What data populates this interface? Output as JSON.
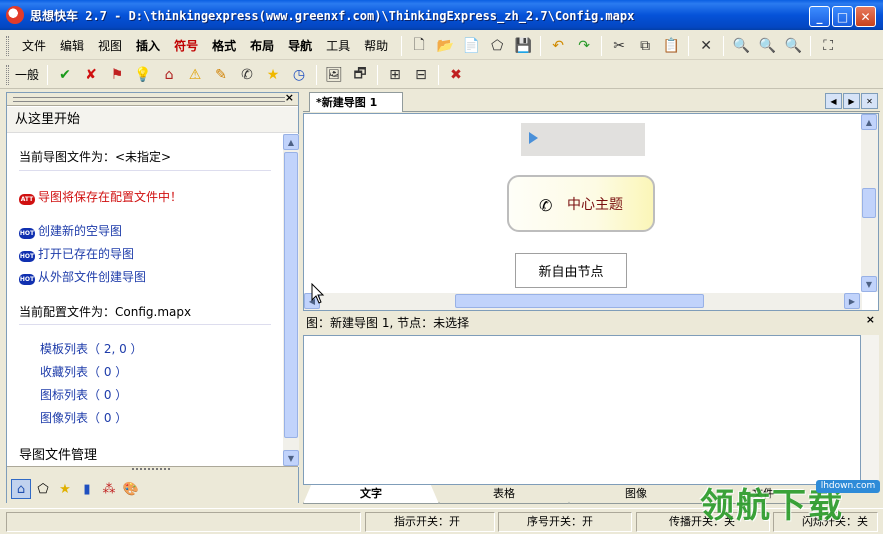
{
  "window": {
    "title": "思想快车 2.7 - D:\\thinkingexpress(www.greenxf.com)\\ThinkingExpress_zh_2.7\\Config.mapx",
    "minimize": "_",
    "maximize": "□",
    "close": "✕"
  },
  "menu": [
    "文件",
    "编辑",
    "视图",
    "插入",
    "符号",
    "格式",
    "布局",
    "导航",
    "工具",
    "帮助"
  ],
  "toolbar2": {
    "label": "一般"
  },
  "left_panel": {
    "close": "×",
    "header": "从这里开始",
    "current_map_label": "当前导图文件为：<未指定>",
    "warning_badge": "ATT",
    "warning_text": "导图将保存在配置文件中！",
    "hot_badge": "HOT",
    "links": [
      "创建新的空导图",
      "打开已存在的导图",
      "从外部文件创建导图"
    ],
    "config_label": "当前配置文件为：Config.mapx",
    "lists": [
      "模板列表（ 2, 0 ）",
      "收藏列表（ 0 ）",
      "图标列表（ 0 ）",
      "图像列表（ 0 ）"
    ],
    "section": "导图文件管理"
  },
  "doc_tab": "*新建导图 1",
  "canvas": {
    "central_topic": "中心主题",
    "free_node": "新自由节点"
  },
  "info_panel": {
    "header": "图：新建导图 1, 节点：未选择",
    "close": "×"
  },
  "bottom_tabs": [
    "文字",
    "表格",
    "图像",
    "文件"
  ],
  "status": [
    "指示开关：开",
    "序号开关：开",
    "传播开关：关",
    "闪烁开关：关"
  ],
  "watermark": {
    "text": "领航下载",
    "url": "lhdown.com"
  }
}
